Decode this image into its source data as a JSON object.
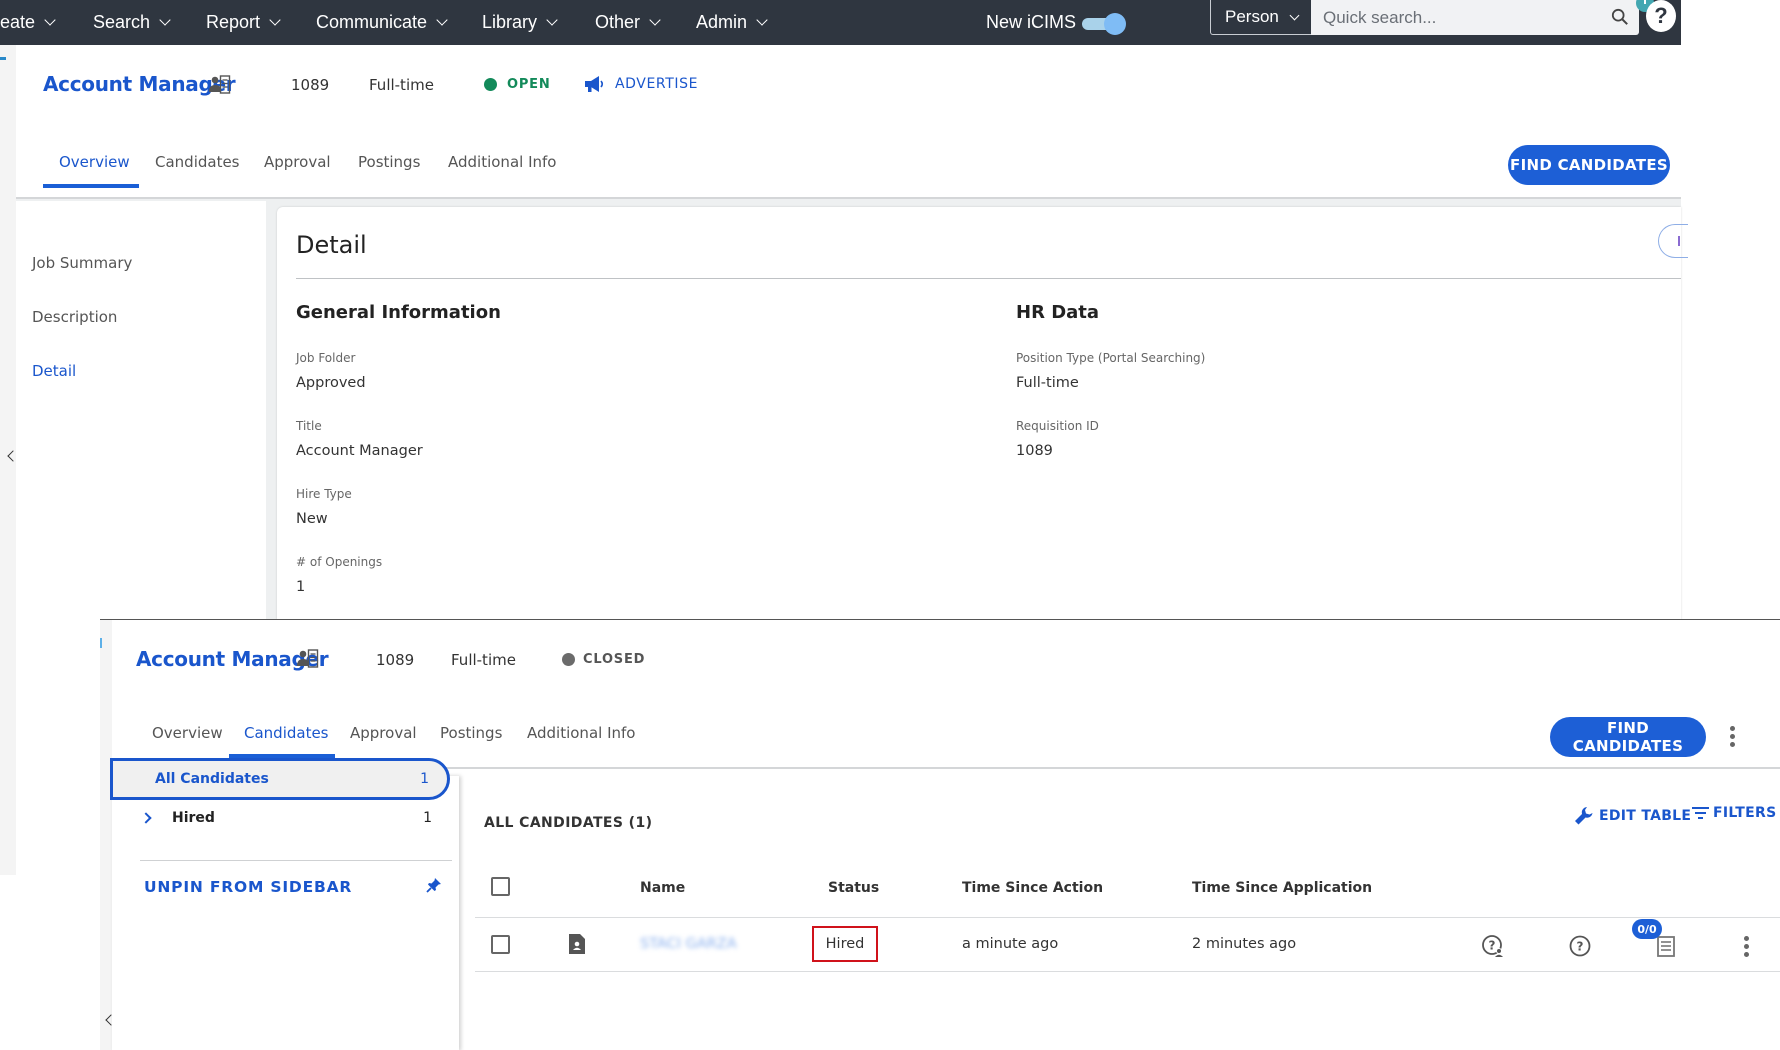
{
  "topnav": {
    "items": [
      {
        "label": "eate"
      },
      {
        "label": "Search"
      },
      {
        "label": "Report"
      },
      {
        "label": "Communicate"
      },
      {
        "label": "Library"
      },
      {
        "label": "Other"
      },
      {
        "label": "Admin"
      }
    ],
    "new_icims_label": "New iCIMS",
    "new_icims_enabled": true,
    "search_type": "Person",
    "search_placeholder": "Quick search...",
    "help_label": "?"
  },
  "overview_panel": {
    "job_title": "Account Manager",
    "job_id": "1089",
    "job_type": "Full-time",
    "status": "OPEN",
    "status_color": "#138a5a",
    "advertise_label": "ADVERTISE",
    "tabs": [
      {
        "label": "Overview",
        "active": true
      },
      {
        "label": "Candidates",
        "active": false
      },
      {
        "label": "Approval",
        "active": false
      },
      {
        "label": "Postings",
        "active": false
      },
      {
        "label": "Additional Info",
        "active": false
      }
    ],
    "find_candidates_label": "FIND CANDIDATES",
    "side_nav": [
      {
        "label": "Job Summary",
        "active": false
      },
      {
        "label": "Description",
        "active": false
      },
      {
        "label": "Detail",
        "active": true
      }
    ],
    "detail": {
      "title": "Detail",
      "general_info": {
        "heading": "General Information",
        "fields": [
          {
            "label": "Job Folder",
            "value": "Approved"
          },
          {
            "label": "Title",
            "value": "Account Manager"
          },
          {
            "label": "Hire Type",
            "value": "New"
          },
          {
            "label": "# of Openings",
            "value": "1"
          }
        ]
      },
      "hr_data": {
        "heading": "HR Data",
        "fields": [
          {
            "label": "Position Type (Portal Searching)",
            "value": "Full-time"
          },
          {
            "label": "Requisition ID",
            "value": "1089"
          }
        ]
      }
    }
  },
  "candidates_panel": {
    "job_title": "Account Manager",
    "job_id": "1089",
    "job_type": "Full-time",
    "status": "CLOSED",
    "status_color": "#6b6b6b",
    "tabs": [
      {
        "label": "Overview",
        "active": false
      },
      {
        "label": "Candidates",
        "active": true
      },
      {
        "label": "Approval",
        "active": false
      },
      {
        "label": "Postings",
        "active": false
      },
      {
        "label": "Additional Info",
        "active": false
      }
    ],
    "find_candidates_label": "FIND CANDIDATES",
    "sidebar": {
      "all_candidates_label": "All Candidates",
      "all_candidates_count": "1",
      "hired_label": "Hired",
      "hired_count": "1",
      "unpin_label": "UNPIN FROM SIDEBAR"
    },
    "list_heading": "ALL CANDIDATES (1)",
    "edit_table_label": "EDIT TABLE",
    "filters_label": "FILTERS",
    "columns": [
      "Name",
      "Status",
      "Time Since Action",
      "Time Since Application"
    ],
    "rows": [
      {
        "name": "STACI GARZA",
        "status": "Hired",
        "time_since_action": "a minute ago",
        "time_since_application": "2 minutes ago",
        "checklist_badge": "0/0"
      }
    ]
  },
  "colors": {
    "nav_bg": "#2f3640",
    "accent": "#1d5fd6",
    "highlight_border": "#d0121b"
  }
}
